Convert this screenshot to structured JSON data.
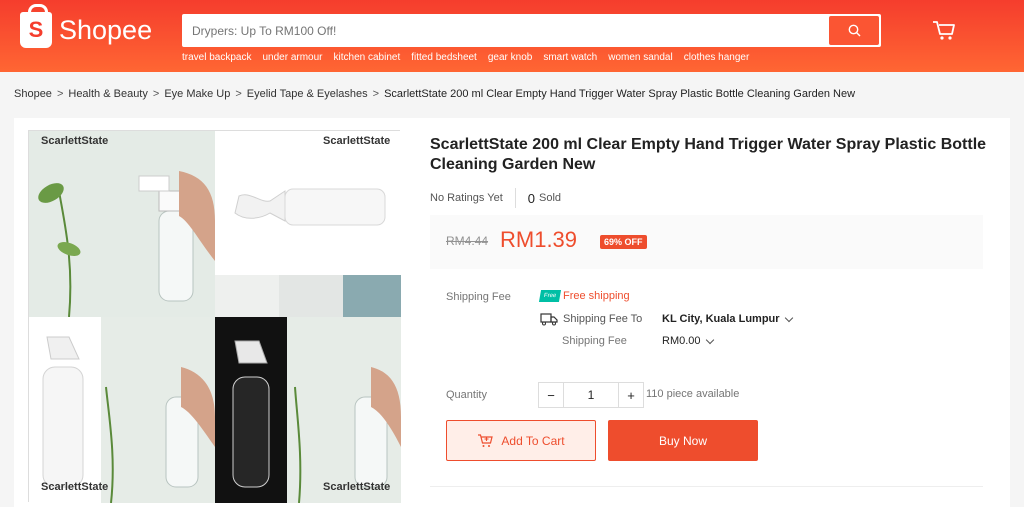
{
  "header": {
    "logo_text": "Shopee",
    "logo_mark": "S",
    "search_placeholder": "Drypers: Up To RM100 Off!",
    "suggestions": [
      "travel backpack",
      "under armour",
      "kitchen cabinet",
      "fitted bedsheet",
      "gear knob",
      "smart watch",
      "women sandal",
      "clothes hanger"
    ],
    "icons": {
      "search": "search-icon",
      "cart": "cart-icon"
    }
  },
  "breadcrumb": [
    "Shopee",
    "Health & Beauty",
    "Eye Make Up",
    "Eyelid Tape & Eyelashes",
    "ScarlettState 200 ml Clear Empty Hand Trigger Water Spray Plastic Bottle Cleaning Garden New"
  ],
  "gallery": {
    "watermark": "ScarlettState"
  },
  "product": {
    "title": "ScarlettState 200 ml Clear Empty Hand Trigger Water Spray Plastic Bottle Cleaning Garden New",
    "ratings_text": "No Ratings Yet",
    "sold_count": "0",
    "sold_label": "Sold",
    "old_price": "RM4.44",
    "price": "RM1.39",
    "discount": "69% OFF"
  },
  "shipping": {
    "label": "Shipping Fee",
    "free_tag": "Free",
    "free_text": "Free shipping",
    "to_label": "Shipping Fee To",
    "to_value": "KL City, Kuala Lumpur",
    "fee_label": "Shipping Fee",
    "fee_value": "RM0.00"
  },
  "quantity": {
    "label": "Quantity",
    "minus": "−",
    "value": "1",
    "plus": "+",
    "available": "110 piece available"
  },
  "actions": {
    "add_to_cart": "Add To Cart",
    "buy_now": "Buy Now"
  },
  "colors": {
    "brand": "#ee4d2d",
    "header_start": "#f53d2d",
    "header_end": "#ff6633",
    "free_ship": "#00bfa5"
  }
}
